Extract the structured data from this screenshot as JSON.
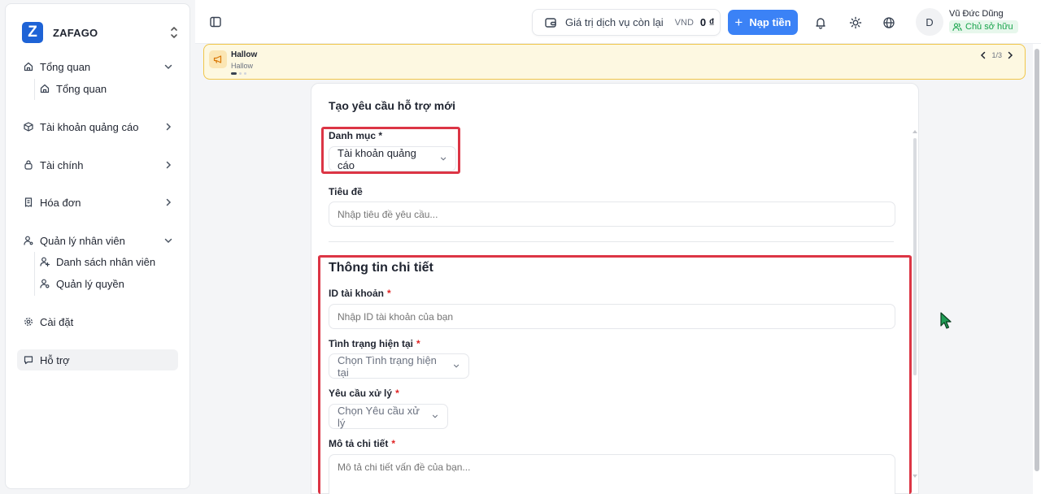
{
  "brand": {
    "logo_letter": "Z",
    "name": "ZAFAGO"
  },
  "sidebar": {
    "items": [
      {
        "label": "Tổng quan",
        "icon": "home-icon",
        "expanded": true,
        "children": [
          {
            "label": "Tổng quan",
            "icon": "home-icon"
          }
        ]
      },
      {
        "label": "Tài khoản quảng cáo",
        "icon": "cube-icon",
        "expanded": false
      },
      {
        "label": "Tài chính",
        "icon": "wallet-bag-icon",
        "expanded": false
      },
      {
        "label": "Hóa đơn",
        "icon": "receipt-icon",
        "expanded": false
      },
      {
        "label": "Quản lý nhân viên",
        "icon": "user-cog-icon",
        "expanded": true,
        "children": [
          {
            "label": "Danh sách nhân viên",
            "icon": "user-plus-icon"
          },
          {
            "label": "Quản lý quyền",
            "icon": "user-key-icon"
          }
        ]
      },
      {
        "label": "Cài đặt",
        "icon": "gear-icon"
      },
      {
        "label": "Hỗ trợ",
        "icon": "chat-icon",
        "active": true
      }
    ]
  },
  "header": {
    "balance_label": "Giá trị dịch vụ còn lại",
    "balance_currency": "VND",
    "balance_value": "0 ₫",
    "topup_label": "Nạp tiền",
    "user": {
      "initial": "D",
      "name": "Vũ Đức Dũng",
      "role": "Chủ sở hữu"
    }
  },
  "banner": {
    "title": "Hallow",
    "subtitle": "Hallow",
    "pager": "1/3"
  },
  "form": {
    "title": "Tạo yêu cầu hỗ trợ mới",
    "category_label": "Danh mục *",
    "category_value": "Tài khoản quảng cáo",
    "subject_label": "Tiêu đề",
    "subject_placeholder": "Nhập tiêu đề yêu cầu...",
    "detail_section_title": "Thông tin chi tiết",
    "account_id_label": "ID tài khoản",
    "account_id_placeholder": "Nhập ID tài khoản của bạn",
    "status_label": "Tình trạng hiện tại",
    "status_placeholder": "Chọn Tình trạng hiện tại",
    "request_label": "Yêu cầu xử lý",
    "request_placeholder": "Chọn Yêu cầu xử lý",
    "description_label": "Mô tả chi tiết",
    "description_placeholder": "Mô tả chi tiết vấn đề của bạn...",
    "required_mark": "*"
  },
  "colors": {
    "accent": "#3b82f6",
    "highlight": "#dc3545",
    "role_badge": "#16a34a",
    "banner_border": "#f0c64a"
  }
}
